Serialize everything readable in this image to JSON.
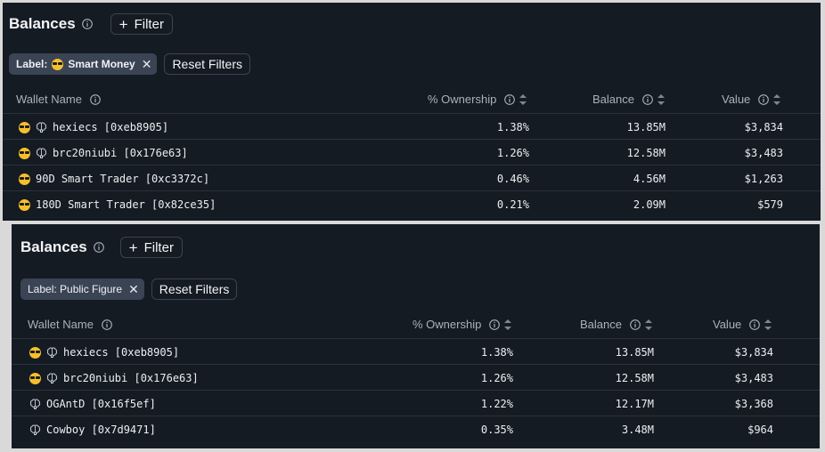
{
  "colors": {
    "panel_bg": "#151b23",
    "divider": "#2b323d",
    "chip_bg": "#3a4455",
    "text": "#eceff3",
    "muted": "#aab1bd",
    "emoji": "#f5c02a"
  },
  "panels": [
    {
      "title": "Balances",
      "filter_label": "Filter",
      "chip_label": "Label:",
      "chip_value": "Smart Money",
      "chip_has_emoji": true,
      "reset_label": "Reset Filters",
      "columns": {
        "wallet": "Wallet Name",
        "ownership": "% Ownership",
        "balance": "Balance",
        "value": "Value"
      },
      "rows": [
        {
          "wallet": "hexiecs [0xeb8905]",
          "ownership": "1.38%",
          "balance": "13.85M",
          "value": "$3,834",
          "icons": [
            "smart-money-icon",
            "brain-icon"
          ]
        },
        {
          "wallet": "brc20niubi [0x176e63]",
          "ownership": "1.26%",
          "balance": "12.58M",
          "value": "$3,483",
          "icons": [
            "smart-money-icon",
            "brain-icon"
          ]
        },
        {
          "wallet": "90D Smart Trader [0xc3372c]",
          "ownership": "0.46%",
          "balance": "4.56M",
          "value": "$1,263",
          "icons": [
            "smart-money-icon"
          ]
        },
        {
          "wallet": "180D Smart Trader [0x82ce35]",
          "ownership": "0.21%",
          "balance": "2.09M",
          "value": "$579",
          "icons": [
            "smart-money-icon"
          ]
        }
      ]
    },
    {
      "title": "Balances",
      "filter_label": "Filter",
      "chip_label": "Label: Public Figure",
      "chip_value": "",
      "chip_has_emoji": false,
      "reset_label": "Reset Filters",
      "columns": {
        "wallet": "Wallet Name",
        "ownership": "% Ownership",
        "balance": "Balance",
        "value": "Value"
      },
      "rows": [
        {
          "wallet": "hexiecs [0xeb8905]",
          "ownership": "1.38%",
          "balance": "13.85M",
          "value": "$3,834",
          "icons": [
            "smart-money-icon",
            "brain-icon"
          ]
        },
        {
          "wallet": "brc20niubi [0x176e63]",
          "ownership": "1.26%",
          "balance": "12.58M",
          "value": "$3,483",
          "icons": [
            "smart-money-icon",
            "brain-icon"
          ]
        },
        {
          "wallet": "OGAntD [0x16f5ef]",
          "ownership": "1.22%",
          "balance": "12.17M",
          "value": "$3,368",
          "icons": [
            "brain-icon"
          ]
        },
        {
          "wallet": "Cowboy [0x7d9471]",
          "ownership": "0.35%",
          "balance": "3.48M",
          "value": "$964",
          "icons": [
            "brain-icon"
          ]
        }
      ]
    }
  ]
}
